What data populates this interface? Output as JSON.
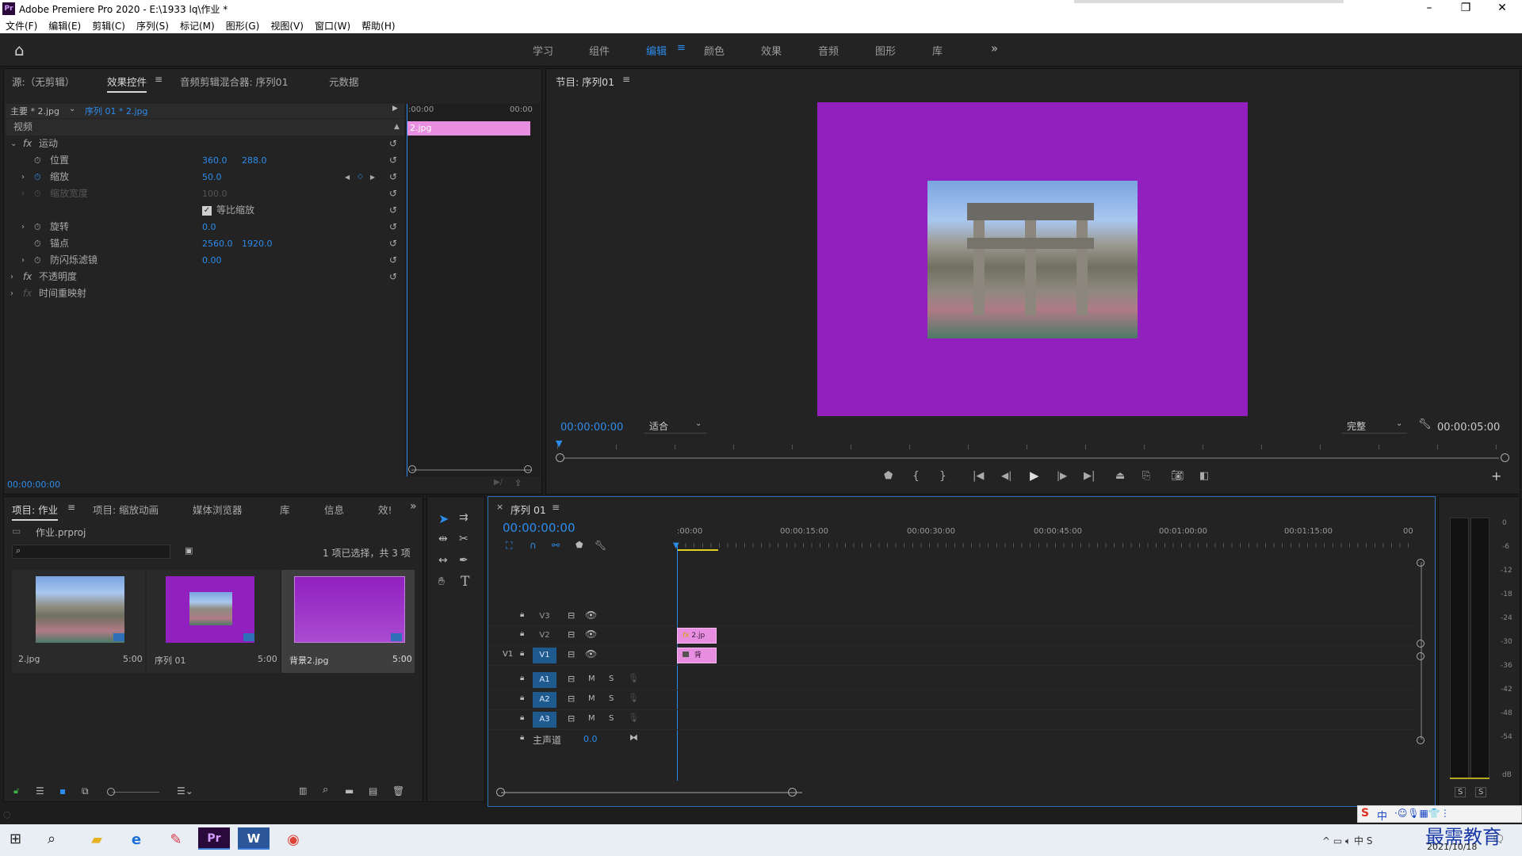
{
  "window": {
    "title": "Adobe Premiere Pro 2020 - E:\\1933 lq\\作业 *",
    "app_badge": "Pr"
  },
  "menu": [
    "文件(F)",
    "编辑(E)",
    "剪辑(C)",
    "序列(S)",
    "标记(M)",
    "图形(G)",
    "视图(V)",
    "窗口(W)",
    "帮助(H)"
  ],
  "workspaces": [
    "学习",
    "组件",
    "编辑",
    "颜色",
    "效果",
    "音频",
    "图形",
    "库"
  ],
  "workspace_active": "编辑",
  "effects_panel": {
    "tabs": [
      "源:（无剪辑）",
      "效果控件",
      "音频剪辑混合器: 序列01",
      "元数据"
    ],
    "active_tab": "效果控件",
    "master_label": "主要 * 2.jpg",
    "sequence_label": "序列 01 * 2.jpg",
    "mini_time_start": ":00:00",
    "mini_time_end": "00:00",
    "clip_name": "2.jpg",
    "section_video": "视频",
    "motion": "运动",
    "position_label": "位置",
    "position_x": "360.0",
    "position_y": "288.0",
    "scale_label": "缩放",
    "scale_value": "50.0",
    "scale_width_label": "缩放宽度",
    "scale_width_value": "100.0",
    "uniform_scale": "等比缩放",
    "rotation_label": "旋转",
    "rotation_value": "0.0",
    "anchor_label": "锚点",
    "anchor_x": "2560.0",
    "anchor_y": "1920.0",
    "flicker_label": "防闪烁滤镜",
    "flicker_value": "0.00",
    "opacity": "不透明度",
    "time_remap": "时间重映射",
    "timecode": "00:00:00:00",
    "fx": "fx"
  },
  "program": {
    "title": "节目: 序列01",
    "timecode": "00:00:00:00",
    "fit": "适合",
    "quality": "完整",
    "duration": "00:00:05:00",
    "bg_color": "#9120bf"
  },
  "project": {
    "tabs": [
      "项目: 作业",
      "项目: 缩放动画",
      "媒体浏览器",
      "库",
      "信息",
      "效!"
    ],
    "file": "作业.prproj",
    "search_placeholder": "",
    "selection_info": "1 项已选择，共 3 项",
    "items": [
      {
        "name": "2.jpg",
        "duration": "5:00"
      },
      {
        "name": "序列 01",
        "duration": "5:00"
      },
      {
        "name": "背景2.jpg",
        "duration": "5:00"
      }
    ]
  },
  "timeline": {
    "title": "序列 01",
    "close": "×",
    "timecode": "00:00:00:00",
    "ruler": [
      ":00:00",
      "00:00:15:00",
      "00:00:30:00",
      "00:00:45:00",
      "00:01:00:00",
      "00:01:15:00",
      "00"
    ],
    "tracks_video": [
      "V3",
      "V2",
      "V1"
    ],
    "tracks_audio": [
      "A1",
      "A2",
      "A3"
    ],
    "source_v1": "V1",
    "master": "主声道",
    "master_value": "0.0",
    "clip_v2": "2.jp",
    "clip_v1": "背",
    "m": "M",
    "s": "S",
    "clip_fx": "fx"
  },
  "meter": {
    "labels": [
      "0",
      "-6",
      "-12",
      "-18",
      "-24",
      "-30",
      "-36",
      "-42",
      "-48",
      "-54",
      "dB"
    ],
    "solo": [
      "S",
      "S"
    ]
  },
  "taskbar": {
    "date": "2021/10/18",
    "watermark": "最需教育",
    "ime": "中"
  },
  "colors": {
    "accent": "#2d8ceb",
    "clip": "#e88ee0",
    "purple": "#9120bf"
  }
}
